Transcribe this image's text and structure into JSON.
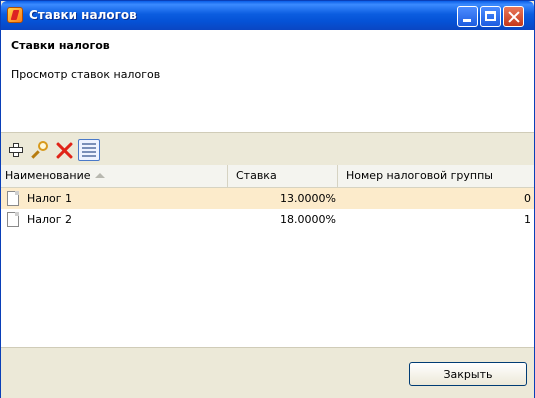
{
  "window": {
    "title": "Ставки налогов"
  },
  "header": {
    "title": "Ставки налогов",
    "subtitle": "Просмотр ставок налогов"
  },
  "toolbar": {
    "icons": [
      "add-icon",
      "search-icon",
      "delete-icon",
      "list-icon"
    ]
  },
  "table": {
    "columns": {
      "name": "Наименование",
      "rate": "Ставка",
      "group": "Номер налоговой группы"
    },
    "sort": {
      "column": "name",
      "direction": "ascending"
    },
    "rows": [
      {
        "name": "Налог 1",
        "rate": "13.0000%",
        "group": "0",
        "selected": true
      },
      {
        "name": "Налог 2",
        "rate": "18.0000%",
        "group": "1",
        "selected": false
      }
    ]
  },
  "footer": {
    "close_label": "Закрыть"
  },
  "colors": {
    "titlebar": "#0552d6",
    "selected_row": "#fcebcb",
    "panel": "#ece9d8"
  }
}
